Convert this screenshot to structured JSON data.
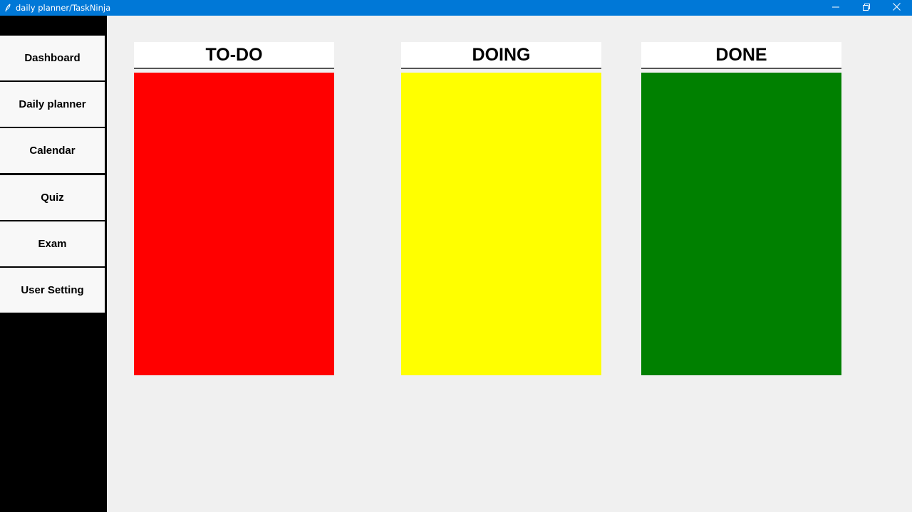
{
  "window": {
    "title": "daily planner/TaskNinja",
    "titlebar_color": "#0078d7",
    "icons": [
      "app-feather-icon",
      "minimize-icon",
      "restore-icon",
      "close-icon"
    ]
  },
  "sidebar": {
    "background": "#000000",
    "items": [
      {
        "label": "Dashboard"
      },
      {
        "label": "Daily planner"
      },
      {
        "label": "Calendar"
      },
      {
        "label": "Quiz"
      },
      {
        "label": "Exam"
      },
      {
        "label": "User Setting"
      }
    ]
  },
  "board": {
    "background": "#f0f0f0",
    "columns": [
      {
        "title": "TO-DO",
        "color": "#ff0000"
      },
      {
        "title": "DOING",
        "color": "#ffff00"
      },
      {
        "title": "DONE",
        "color": "#008000"
      }
    ]
  }
}
